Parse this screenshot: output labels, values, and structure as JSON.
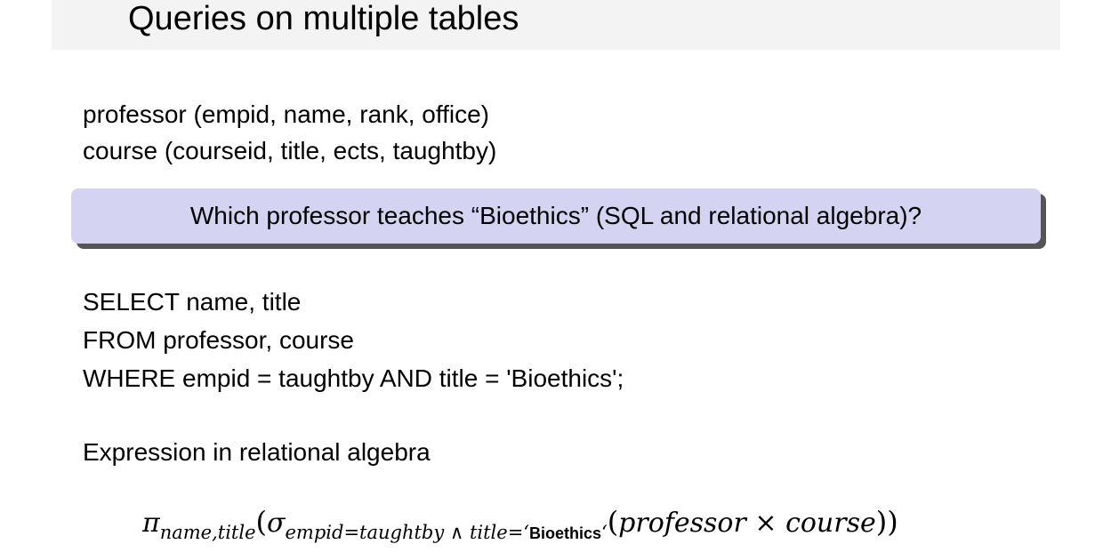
{
  "slide": {
    "title": "Queries on multiple tables",
    "schema": {
      "line1": "professor (empid, name, rank, office)",
      "line2": "course (courseid, title, ects, taughtby)"
    },
    "question": "Which professor teaches “Bioethics” (SQL and relational algebra)?",
    "sql": {
      "line1": "SELECT name, title",
      "line2": "FROM professor, course",
      "line3": "WHERE empid = taughtby AND title = 'Bioethics';"
    },
    "algebra_heading": "Expression in relational algebra",
    "formula": {
      "pi": "π",
      "pi_sub": "name,title",
      "open1": "(",
      "sigma": "σ",
      "sigma_sub": "empid=taughtby ∧ title=‘",
      "sigma_sub_value": "Bioethics",
      "sigma_sub_close": "‘",
      "open2": "(",
      "left_operand": "professor",
      "times": " × ",
      "right_operand": "course",
      "close": "))"
    },
    "colors": {
      "title_bar": "#f3f3f3",
      "question_box": "#d4d4f2",
      "question_shadow": "#555555"
    }
  }
}
